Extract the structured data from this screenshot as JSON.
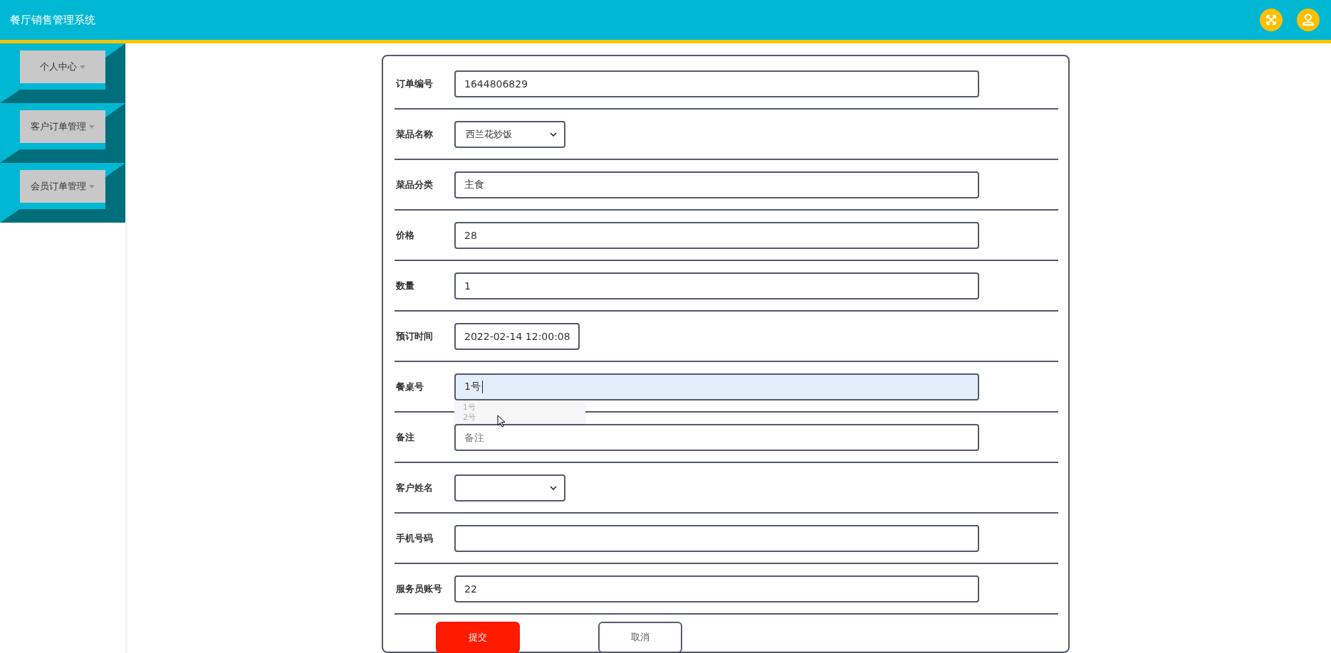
{
  "header": {
    "title": "餐厅销售管理系统"
  },
  "sidebar": {
    "items": [
      {
        "label": "个人中心"
      },
      {
        "label": "客户订单管理"
      },
      {
        "label": "会员订单管理"
      }
    ]
  },
  "form": {
    "fields": [
      {
        "label": "订单编号",
        "kind": "text",
        "value": "1644806829"
      },
      {
        "label": "菜品名称",
        "kind": "select",
        "value": "西兰花炒饭"
      },
      {
        "label": "菜品分类",
        "kind": "text",
        "value": "主食"
      },
      {
        "label": "价格",
        "kind": "text",
        "value": "28"
      },
      {
        "label": "数量",
        "kind": "text",
        "value": "1"
      },
      {
        "label": "预订时间",
        "kind": "date",
        "value": "2022-02-14 12:00:08"
      },
      {
        "label": "餐桌号",
        "kind": "text",
        "value": "1号",
        "focused": true,
        "suggestions": [
          "1号",
          "2号"
        ]
      },
      {
        "label": "备注",
        "kind": "text",
        "placeholder": "备注"
      },
      {
        "label": "客户姓名",
        "kind": "select"
      },
      {
        "label": "手机号码",
        "kind": "text"
      },
      {
        "label": "服务员账号",
        "kind": "text",
        "value": "22"
      }
    ],
    "buttons": [
      {
        "label": "提交",
        "kind": "primary"
      },
      {
        "label": "取消",
        "kind": "secondary"
      }
    ]
  }
}
